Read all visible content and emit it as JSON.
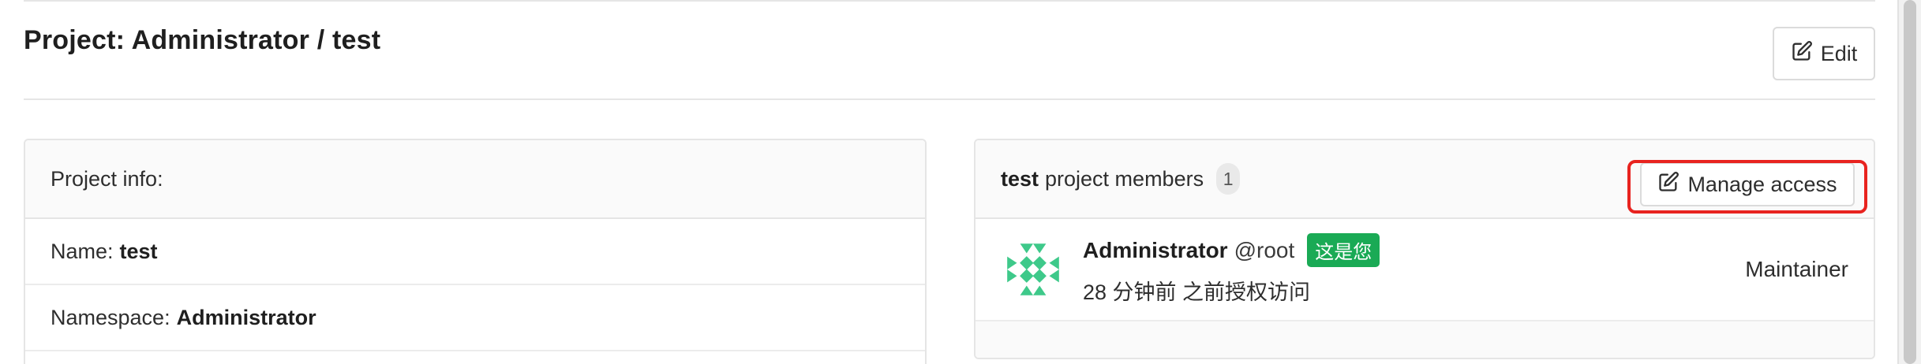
{
  "header": {
    "title": "Project: Administrator / test",
    "edit_label": "Edit"
  },
  "project_info": {
    "heading": "Project info:",
    "rows": [
      {
        "label": "Name:",
        "value": "test"
      },
      {
        "label": "Namespace:",
        "value": "Administrator"
      }
    ]
  },
  "members": {
    "project_name": "test",
    "heading_rest": "project members",
    "count": "1",
    "manage_label": "Manage access",
    "list": [
      {
        "name": "Administrator",
        "username": "@root",
        "badge": "这是您",
        "granted": "28 分钟前 之前授权访问",
        "role": "Maintainer"
      }
    ]
  },
  "colors": {
    "accent_green": "#1aaa55",
    "highlight_red": "#e8231f",
    "avatar_green": "#3ec98a"
  },
  "icons": {
    "edit": "edit-icon"
  }
}
